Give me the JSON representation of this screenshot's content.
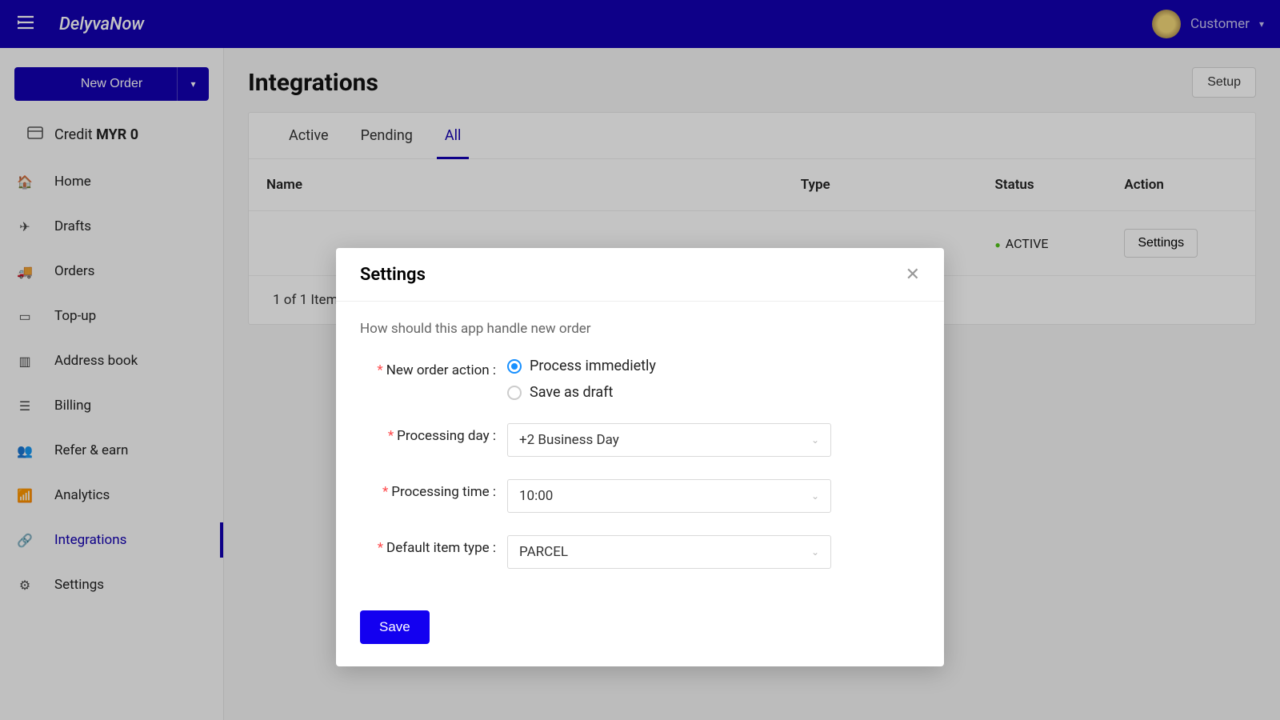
{
  "header": {
    "brand": "DelyvaNow",
    "user_label": "Customer"
  },
  "sidebar": {
    "new_order_label": "New Order",
    "credit_label": "Credit",
    "credit_amount": "MYR 0",
    "items": [
      {
        "label": "Home",
        "icon": "home"
      },
      {
        "label": "Drafts",
        "icon": "send"
      },
      {
        "label": "Orders",
        "icon": "truck"
      },
      {
        "label": "Top-up",
        "icon": "wallet"
      },
      {
        "label": "Address book",
        "icon": "book"
      },
      {
        "label": "Billing",
        "icon": "list"
      },
      {
        "label": "Refer & earn",
        "icon": "users"
      },
      {
        "label": "Analytics",
        "icon": "chart"
      },
      {
        "label": "Integrations",
        "icon": "link"
      },
      {
        "label": "Settings",
        "icon": "gear"
      }
    ],
    "active_index": 8
  },
  "page": {
    "title": "Integrations",
    "setup_label": "Setup",
    "tabs": [
      "Active",
      "Pending",
      "All"
    ],
    "active_tab_index": 2,
    "columns": {
      "name": "Name",
      "type": "Type",
      "status": "Status",
      "action": "Action"
    },
    "row": {
      "status": "ACTIVE",
      "action_label": "Settings"
    },
    "footer": "1 of 1 Item"
  },
  "modal": {
    "title": "Settings",
    "intro": "How should this app handle new order",
    "labels": {
      "new_order_action": "New order action",
      "processing_day": "Processing day",
      "processing_time": "Processing time",
      "default_item_type": "Default item type"
    },
    "radio_options": {
      "process": "Process immedietly",
      "draft": "Save as draft"
    },
    "radio_selected": "process",
    "processing_day_value": "+2 Business Day",
    "processing_time_value": "10:00",
    "default_item_type_value": "PARCEL",
    "save_label": "Save"
  }
}
